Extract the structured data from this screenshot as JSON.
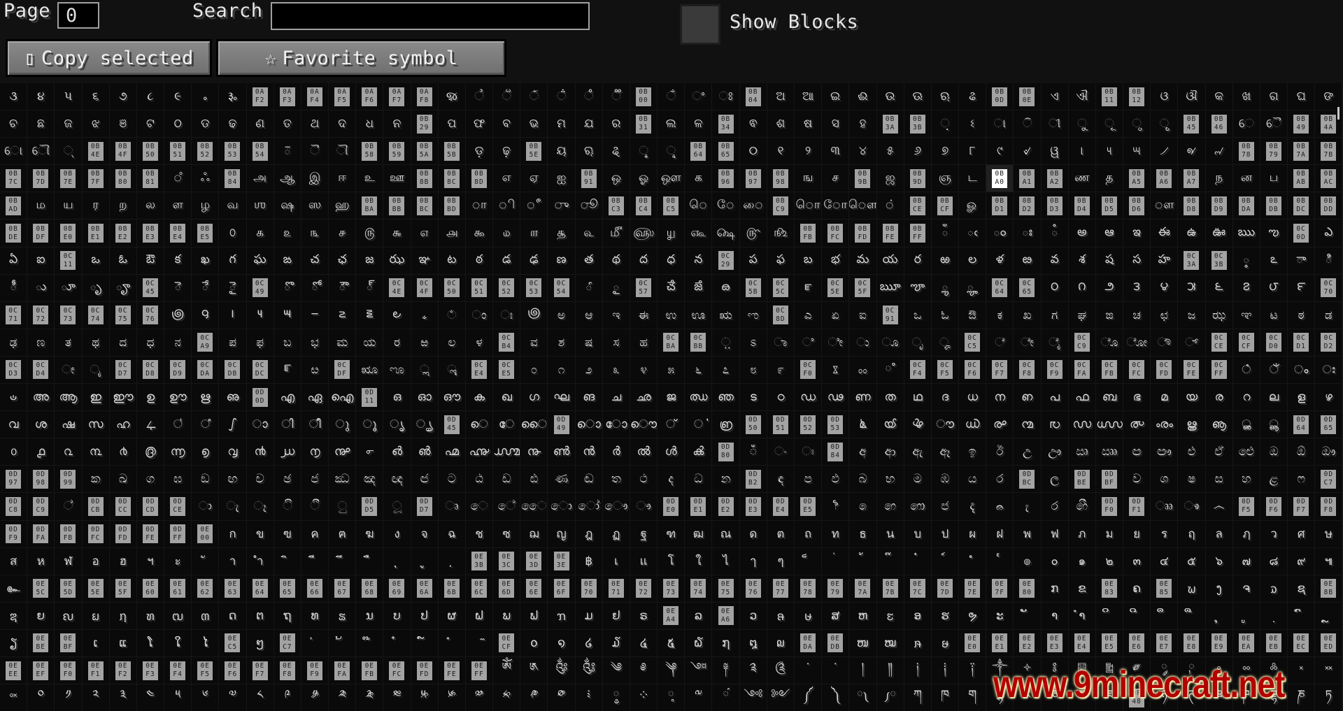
{
  "toolbar": {
    "page_label": "Page",
    "page_value": "0",
    "search_label": "Search",
    "search_value": "",
    "show_blocks_label": "Show Blocks",
    "show_blocks_checked": false,
    "copy_icon": "clipboard-icon",
    "copy_glyph": "▯",
    "copy_label": "Copy selected",
    "favorite_icon": "star-icon",
    "favorite_glyph": "☆",
    "favorite_label": "Favorite symbol"
  },
  "grid": {
    "first_codepoint": "0AE9",
    "columns": 49,
    "rows": 23,
    "hovered_codepoint": "0BA0",
    "missing_glyph_style": "hex-box"
  },
  "colors": {
    "background": "#111111",
    "cell": "#0a0a0a",
    "hex_box": "#a3a3a3",
    "hex_box_hover": "#ffffff"
  },
  "watermark": "www.9minecraft.net"
}
